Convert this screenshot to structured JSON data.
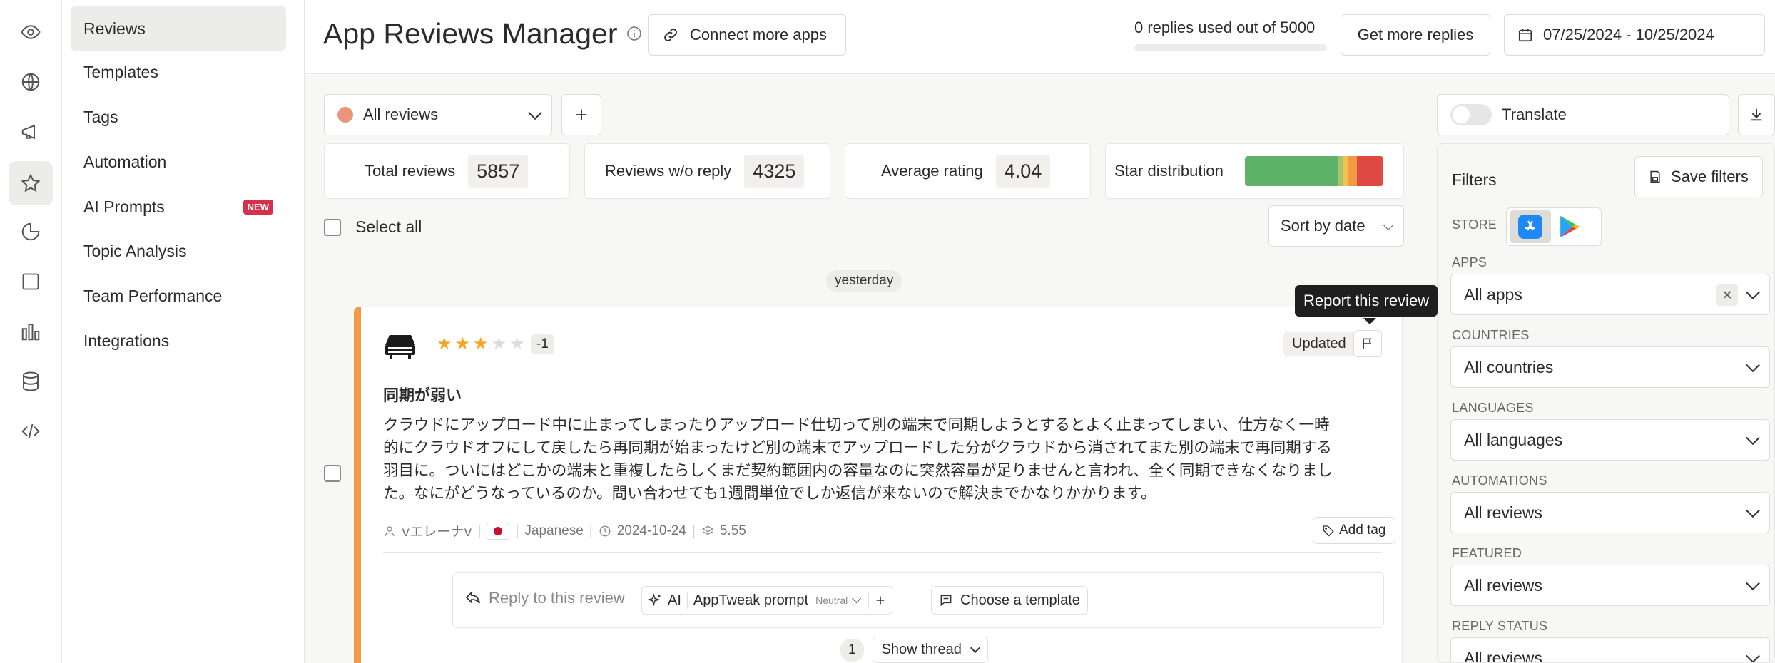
{
  "colors": {
    "accent": "#f09a45",
    "new_badge": "#d6314a",
    "dot": "#e8957a"
  },
  "rail": {
    "icons": [
      "eye-icon",
      "globe-icon",
      "megaphone-icon",
      "star-icon",
      "pie-chart-icon",
      "square-icon",
      "bar-chart-icon",
      "database-icon",
      "code-icon"
    ]
  },
  "nav": {
    "items": [
      {
        "label": "Reviews"
      },
      {
        "label": "Templates"
      },
      {
        "label": "Tags"
      },
      {
        "label": "Automation"
      },
      {
        "label": "AI Prompts",
        "badge": "NEW"
      },
      {
        "label": "Topic Analysis"
      },
      {
        "label": "Team Performance"
      },
      {
        "label": "Integrations"
      }
    ]
  },
  "header": {
    "title": "App Reviews Manager",
    "connect_label": "Connect more apps",
    "replies_used": "0 replies used out of 5000",
    "replies_progress": 0,
    "get_more_label": "Get more replies",
    "date_range": "07/25/2024 - 10/25/2024"
  },
  "toolbar": {
    "view_select": "All reviews",
    "translate_label": "Translate",
    "select_all": "Select all",
    "sort_label": "Sort by date"
  },
  "stats": {
    "total_label": "Total reviews",
    "total_value": "5857",
    "noreply_label": "Reviews w/o reply",
    "noreply_value": "4325",
    "avg_label": "Average rating",
    "avg_value": "4.04",
    "dist_label": "Star distribution"
  },
  "date_group": "yesterday",
  "tooltip": "Report this review",
  "review": {
    "rating": 3,
    "rating_change": "-1",
    "status": "Updated",
    "title": "同期が弱い",
    "body_lines": [
      "クラウドにアップロード中に止まってしまったりアップロード仕切って別の端末で同期しようとするとよく止まってしまい、仕方なく一時",
      "的にクラウドオフにして戻したら再同期が始まったけど別の端末でアップロードした分がクラウドから消されてまた別の端末で再同期する",
      "羽目に。ついにはどこかの端末と重複したらしくまだ契約範囲内の容量なのに突然容量が足りませんと言われ、全く同期できなくなりまし",
      "た。なにがどうなっているのか。問い合わせても1週間単位でしか返信が来ないので解決までかなりかかります。"
    ],
    "author": "vエレーナv",
    "language": "Japanese",
    "date": "2024-10-24",
    "version": "5.55",
    "add_tag": "Add tag",
    "reply_placeholder": "Reply to this review",
    "ai_label": "AI",
    "prompt_label": "AppTweak prompt",
    "tone_label": "Neutral",
    "template_label": "Choose a template",
    "thread_count": "1",
    "show_thread": "Show thread"
  },
  "filters": {
    "title": "Filters",
    "save_label": "Save filters",
    "store_label": "STORE",
    "apps_label": "APPS",
    "apps_value": "All apps",
    "countries_label": "COUNTRIES",
    "countries_value": "All countries",
    "languages_label": "LANGUAGES",
    "languages_value": "All languages",
    "automations_label": "AUTOMATIONS",
    "automations_value": "All reviews",
    "featured_label": "FEATURED",
    "featured_value": "All reviews",
    "reply_status_label": "REPLY STATUS",
    "reply_status_value": "All reviews"
  }
}
